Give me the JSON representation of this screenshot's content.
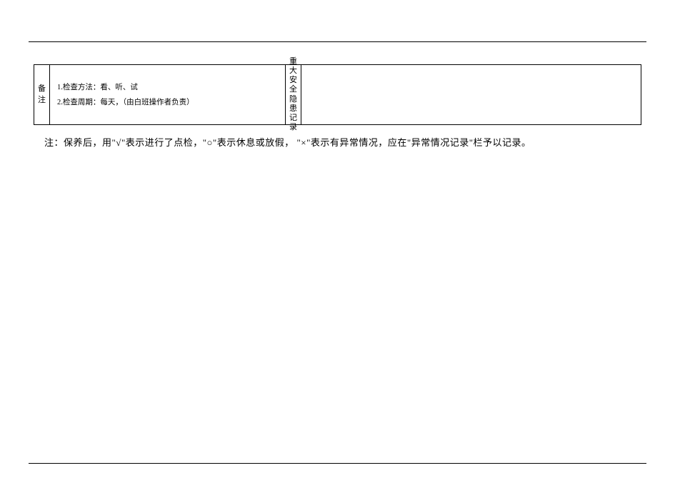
{
  "table": {
    "col1_label": "备注",
    "body_line1": "1.检查方法：看、听、试",
    "body_line2": "2.检查周期：每天，（由白班操作者负责）",
    "col3_label": "重大安全隐患记录"
  },
  "footer_note": "注：保养后，用\"√\"表示进行了点检，\"○\"表示休息或放假，   \"×\"表示有异常情况，应在\"异常情况记录\"栏予以记录。"
}
